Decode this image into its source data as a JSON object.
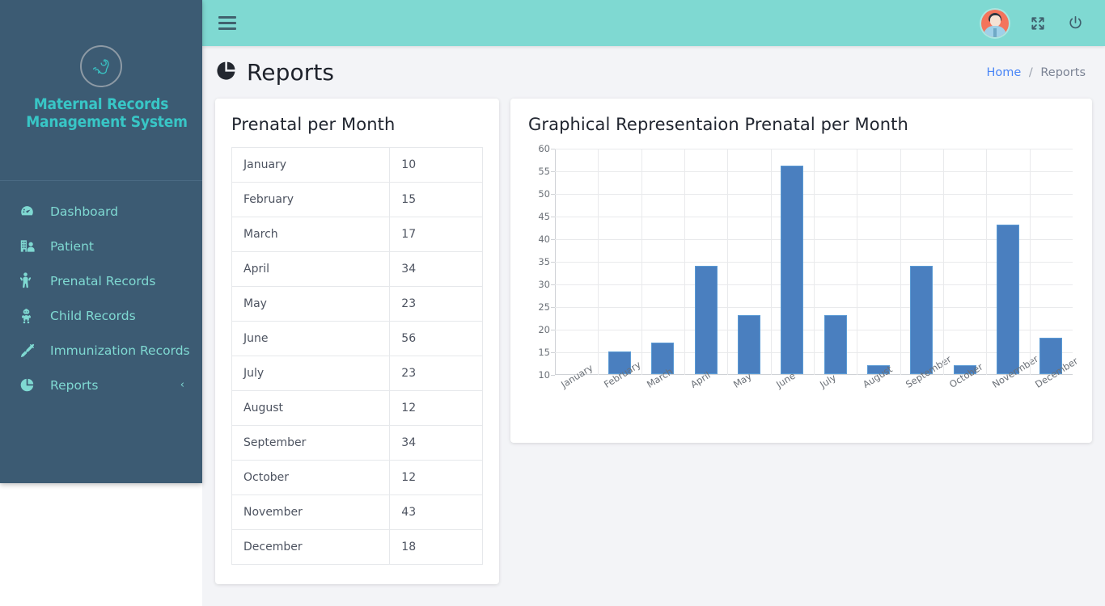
{
  "brand": {
    "logo_icon": "fetus-icon",
    "line1": "Maternal Records",
    "line2": "Management System",
    "color": "#38c6c6"
  },
  "sidebar": {
    "background": "#3c5b73",
    "items": [
      {
        "label": "Dashboard",
        "icon": "speedometer-icon",
        "caret": ""
      },
      {
        "label": "Patient",
        "icon": "hospital-user-icon",
        "caret": ""
      },
      {
        "label": "Prenatal Records",
        "icon": "pregnant-woman-icon",
        "caret": ""
      },
      {
        "label": "Child Records",
        "icon": "baby-icon",
        "caret": ""
      },
      {
        "label": "Immunization Records",
        "icon": "syringe-icon",
        "caret": ""
      },
      {
        "label": "Reports",
        "icon": "pie-chart-icon",
        "caret": "‹"
      }
    ]
  },
  "header": {
    "background": "#7fd9d2",
    "menu_icon": "hamburger-icon",
    "avatar_icon": "user-avatar",
    "fullscreen_icon": "expand-arrows-icon",
    "power_icon": "power-off-icon"
  },
  "page": {
    "title": "Reports",
    "title_icon": "pie-chart-icon",
    "breadcrumb": {
      "home": "Home",
      "separator": "/",
      "current": "Reports"
    }
  },
  "table_card": {
    "title": "Prenatal per Month",
    "rows": [
      {
        "month": "January",
        "value": "10"
      },
      {
        "month": "February",
        "value": "15"
      },
      {
        "month": "March",
        "value": "17"
      },
      {
        "month": "April",
        "value": "34"
      },
      {
        "month": "May",
        "value": "23"
      },
      {
        "month": "June",
        "value": "56"
      },
      {
        "month": "July",
        "value": "23"
      },
      {
        "month": "August",
        "value": "12"
      },
      {
        "month": "September",
        "value": "34"
      },
      {
        "month": "October",
        "value": "12"
      },
      {
        "month": "November",
        "value": "43"
      },
      {
        "month": "December",
        "value": "18"
      }
    ]
  },
  "chart_card": {
    "title": "Graphical Representaion Prenatal per Month"
  },
  "chart_data": {
    "type": "bar",
    "title": "Graphical Representaion Prenatal per Month",
    "xlabel": "",
    "ylabel": "",
    "categories": [
      "January",
      "February",
      "March",
      "April",
      "May",
      "June",
      "July",
      "August",
      "September",
      "October",
      "Novermber",
      "December"
    ],
    "values": [
      10,
      15,
      17,
      34,
      23,
      56,
      23,
      12,
      34,
      12,
      43,
      18
    ],
    "ylim": [
      10,
      60
    ],
    "yticks": [
      10,
      15,
      20,
      25,
      30,
      35,
      40,
      45,
      50,
      55,
      60
    ],
    "grid": true,
    "legend": "none",
    "bar_color": "#4a7fbf",
    "bar_border_color": "#5b9bd5",
    "xtick_rotation": -32
  }
}
